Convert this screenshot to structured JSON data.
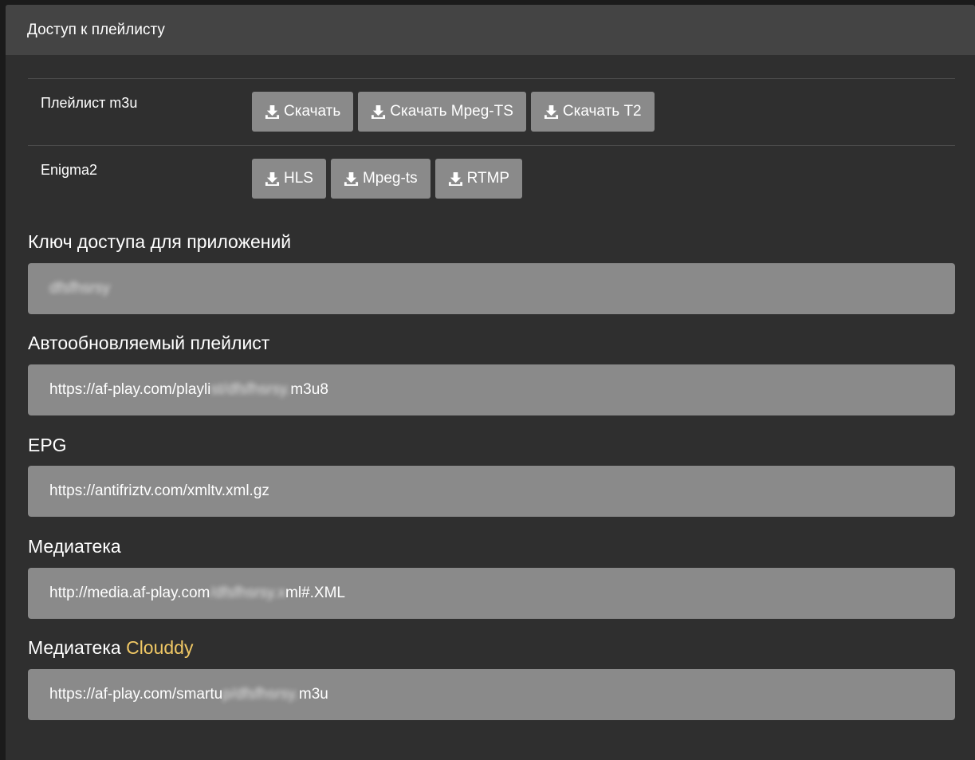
{
  "panel": {
    "title": "Доступ к плейлисту"
  },
  "downloads": [
    {
      "label": "Плейлист m3u",
      "buttons": [
        "Скачать",
        "Скачать Mpeg-TS",
        "Скачать T2"
      ]
    },
    {
      "label": "Enigma2",
      "buttons": [
        "HLS",
        "Mpeg-ts",
        "RTMP"
      ]
    }
  ],
  "key": {
    "title": "Ключ доступа для приложений",
    "value": "dfsfhsrsy"
  },
  "autoplaylist": {
    "title": "Автообновляемый плейлист",
    "value_start": "https://af-play.com/playli",
    "value_hidden": "st/dfsfhsrsy.",
    "value_end": "m3u8"
  },
  "epg": {
    "title": "EPG",
    "value": "https://antifriztv.com/xmltv.xml.gz"
  },
  "mediateka": {
    "title": "Медиатека",
    "value_start": "http://media.af-play.com",
    "value_hidden": "/dfsfhsrsy.x",
    "value_end": "ml#.XML"
  },
  "clouddy": {
    "title_prefix": "Медиатека ",
    "title_accent": "Clouddy",
    "value_start": "https://af-play.com/smartu",
    "value_hidden": "p/dfsfhsrsy.",
    "value_end": "m3u"
  },
  "colors": {
    "panel_bg": "#2f2f2f",
    "header_bg": "#444444",
    "button_bg": "#8a8a8a",
    "field_bg": "#8a8a8a",
    "accent": "#f0c865"
  },
  "icons": {
    "button_icon": "download-icon"
  }
}
